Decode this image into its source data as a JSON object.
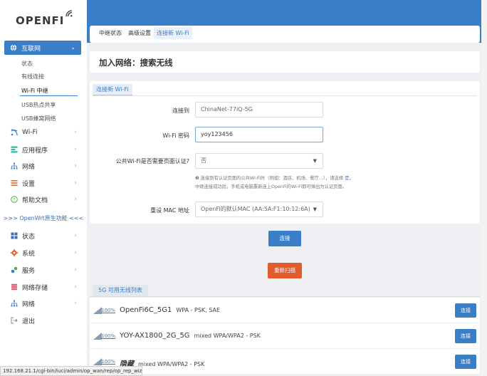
{
  "brand": {
    "logo_text": "OPENFI"
  },
  "sidebar": {
    "active_section": {
      "label": "互联网",
      "icon": "globe-icon"
    },
    "sub_items": [
      {
        "label": "状态"
      },
      {
        "label": "有线连接"
      },
      {
        "label": "Wi-Fi 中继"
      },
      {
        "label": "USB热点共享"
      },
      {
        "label": "USB蜂窝网络"
      }
    ],
    "items": [
      {
        "label": "Wi-Fi",
        "icon": "wifi-icon",
        "color": "#3b7ec8"
      },
      {
        "label": "应用程序",
        "icon": "apps-icon",
        "color": "#2fb6a3"
      },
      {
        "label": "网络",
        "icon": "network-icon",
        "color": "#3b7ec8"
      },
      {
        "label": "设置",
        "icon": "settings-list-icon",
        "color": "#e36a32"
      },
      {
        "label": "帮助文档",
        "icon": "help-icon",
        "color": "#53b043"
      }
    ],
    "divider": ">>> OpenWrt原生功能 <<<",
    "native_items": [
      {
        "label": "状态",
        "icon": "status-grid-icon"
      },
      {
        "label": "系统",
        "icon": "gear-icon"
      },
      {
        "label": "服务",
        "icon": "services-icon"
      },
      {
        "label": "网络存储",
        "icon": "storage-icon"
      },
      {
        "label": "网络",
        "icon": "network-icon"
      },
      {
        "label": "退出",
        "icon": "logout-icon"
      }
    ]
  },
  "tabs": [
    {
      "label": "中继状态"
    },
    {
      "label": "高级设置"
    },
    {
      "label": "连接新 Wi-Fi"
    }
  ],
  "page": {
    "title": "加入网络：搜索无线"
  },
  "form": {
    "tab": "连接新 Wi-Fi",
    "connect_to_label": "连接到",
    "connect_to_value": "ChinaNet-77iQ-5G",
    "password_label": "Wi-Fi 密码",
    "password_value": "yoy123456",
    "portal_label": "公共Wi-Fi是否需要页面认证?",
    "portal_value": "否",
    "portal_hint_1a": "❷ 连接到有认证页面的公共Wi-Fi时（例如：酒店、机场、餐厅...），请选择",
    "portal_hint_1b": "是",
    "portal_hint_1c": "。",
    "portal_hint_2": "中继连接成功后，手机或电脑重新连上OpenFi的Wi-Fi即可弹出为认证页面。",
    "mac_label": "重设 MAC 地址",
    "mac_value": "OpenFi的默认MAC (AA:5A:F1:10:12:6A)"
  },
  "buttons": {
    "connect": "连接",
    "rescan": "重新扫描"
  },
  "wifi_list": {
    "tab": "5G 可用无线列表",
    "networks": [
      {
        "signal": "100%",
        "ssid": "OpenFi6C_5G1",
        "encryption": "WPA - PSK, SAE",
        "button": "连接"
      },
      {
        "signal": "100%",
        "ssid": "YOY-AX1800_2G_5G",
        "encryption": "mixed WPA/WPA2 - PSK",
        "button": "连接"
      },
      {
        "signal": "100%",
        "ssid": "隐藏",
        "encryption": "mixed WPA/WPA2 - PSK",
        "button": "连接"
      }
    ]
  },
  "statusbar": {
    "url": "192.168.21.1/cgi-bin/luci/admin/op_wan/rep/op_rep_wiz#"
  }
}
